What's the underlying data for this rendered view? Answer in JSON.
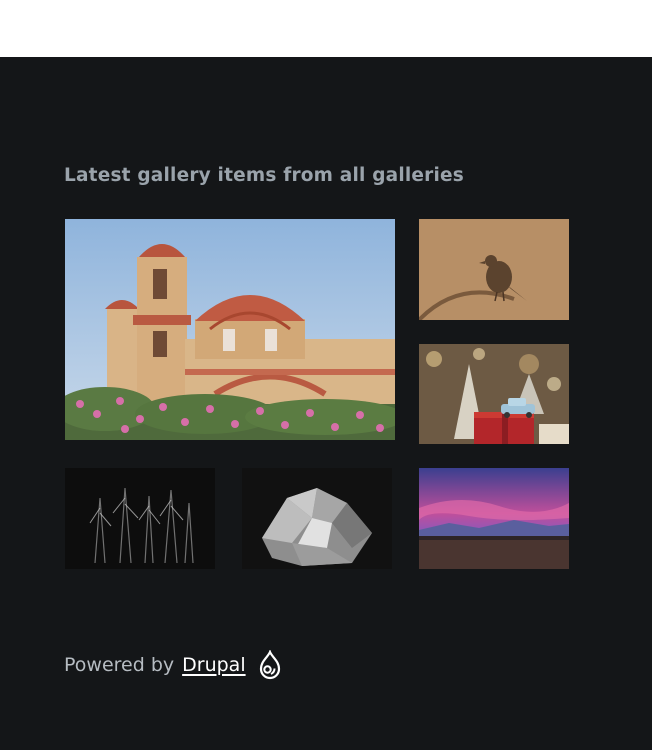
{
  "gallery_block": {
    "title": "Latest gallery items from all galleries",
    "items": [
      {
        "subject": "church"
      },
      {
        "subject": "bird"
      },
      {
        "subject": "christmas-car"
      },
      {
        "subject": "dark-trees"
      },
      {
        "subject": "crystal"
      },
      {
        "subject": "sunset-mountains"
      }
    ]
  },
  "footer": {
    "powered_prefix": "Powered by",
    "link_label": "Drupal",
    "icon": "drupal-drop-icon",
    "background": "#141618",
    "text_color": "#b6bcc2"
  }
}
